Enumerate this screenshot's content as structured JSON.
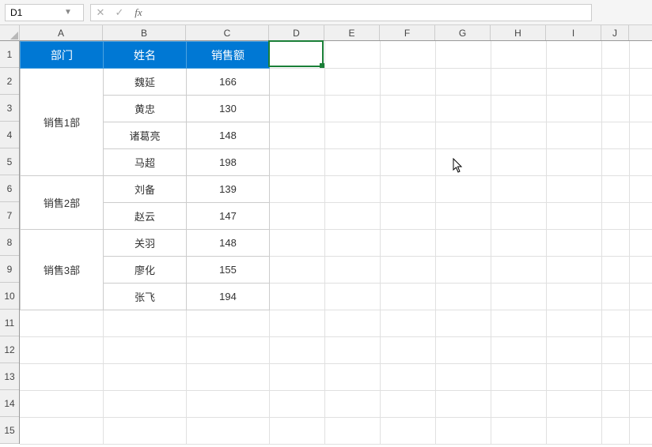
{
  "namebox": {
    "value": "D1"
  },
  "formula_bar": {
    "value": ""
  },
  "columns": [
    "A",
    "B",
    "C",
    "D",
    "E",
    "F",
    "G",
    "H",
    "I",
    "J"
  ],
  "rows": [
    "1",
    "2",
    "3",
    "4",
    "5",
    "6",
    "7",
    "8",
    "9",
    "10",
    "11",
    "12",
    "13",
    "14",
    "15"
  ],
  "table": {
    "headers": [
      "部门",
      "姓名",
      "销售额"
    ],
    "groups": [
      {
        "dept": "销售1部",
        "rows": [
          {
            "name": "魏延",
            "sales": "166"
          },
          {
            "name": "黄忠",
            "sales": "130"
          },
          {
            "name": "诸葛亮",
            "sales": "148"
          },
          {
            "name": "马超",
            "sales": "198"
          }
        ]
      },
      {
        "dept": "销售2部",
        "rows": [
          {
            "name": "刘备",
            "sales": "139"
          },
          {
            "name": "赵云",
            "sales": "147"
          }
        ]
      },
      {
        "dept": "销售3部",
        "rows": [
          {
            "name": "关羽",
            "sales": "148"
          },
          {
            "name": "廖化",
            "sales": "155"
          },
          {
            "name": "张飞",
            "sales": "194"
          }
        ]
      }
    ]
  },
  "selection": {
    "cell": "D1"
  }
}
